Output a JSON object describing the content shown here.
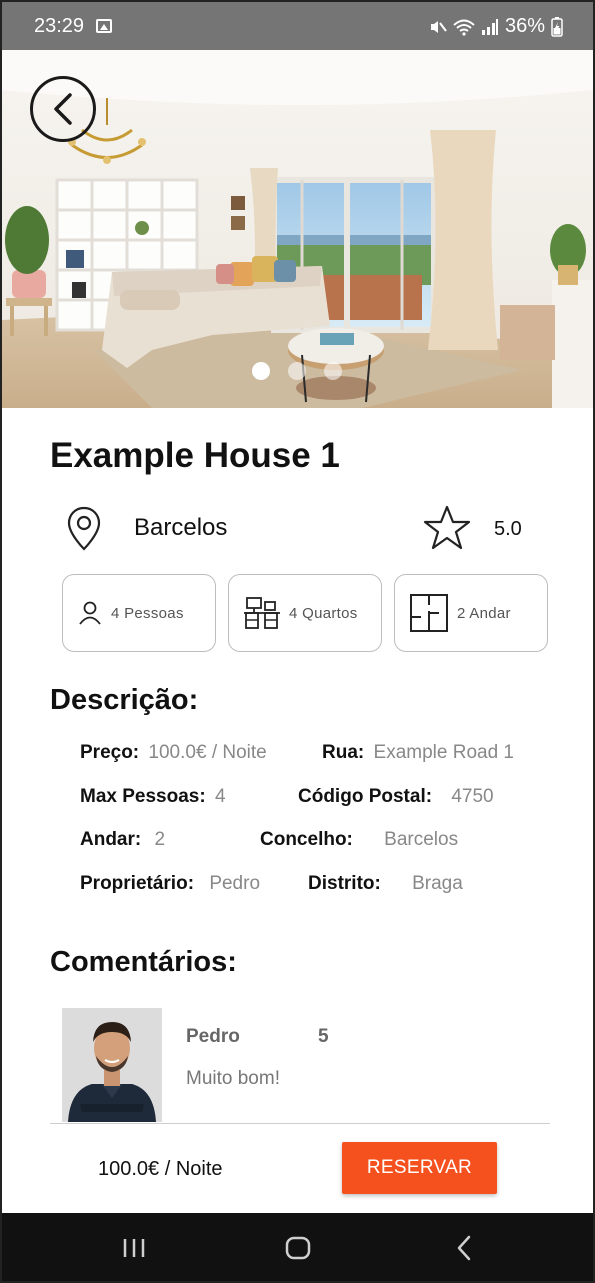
{
  "status_bar": {
    "time": "23:29",
    "battery": "36%",
    "icons": [
      "image-icon",
      "mute-icon",
      "wifi-icon",
      "signal-icon",
      "battery-icon"
    ]
  },
  "hero": {
    "image_description_icon": "living-room-photo",
    "carousel_count": 3,
    "carousel_active": 0
  },
  "listing": {
    "title": "Example House 1",
    "location": "Barcelos",
    "rating": "5.0"
  },
  "features": [
    {
      "icon": "person-icon",
      "label": "4  Pessoas"
    },
    {
      "icon": "desk-icon",
      "label": "4  Quartos"
    },
    {
      "icon": "floorplan-icon",
      "label": "2  Andar"
    }
  ],
  "description": {
    "heading": "Descrição:",
    "price_label": "Preço:",
    "price_value": "100.0€ / Noite",
    "street_label": "Rua:",
    "street_value": "Example Road 1",
    "max_label": "Max Pessoas:",
    "max_value": "4",
    "postal_label": "Código Postal:",
    "postal_value": "4750",
    "floor_label": "Andar:",
    "floor_value": "2",
    "county_label": "Concelho:",
    "county_value": "Barcelos",
    "owner_label": "Proprietário:",
    "owner_value": "Pedro",
    "district_label": "Distrito:",
    "district_value": "Braga"
  },
  "comments": {
    "heading": "Comentários:",
    "items": [
      {
        "name": "Pedro",
        "score": "5",
        "text": "Muito bom!"
      }
    ]
  },
  "footer": {
    "price": "100.0€ / Noite",
    "reserve_label": "RESERVAR"
  },
  "colors": {
    "accent": "#f4511e",
    "status_bar": "#757575",
    "nav_bar": "#111111"
  }
}
